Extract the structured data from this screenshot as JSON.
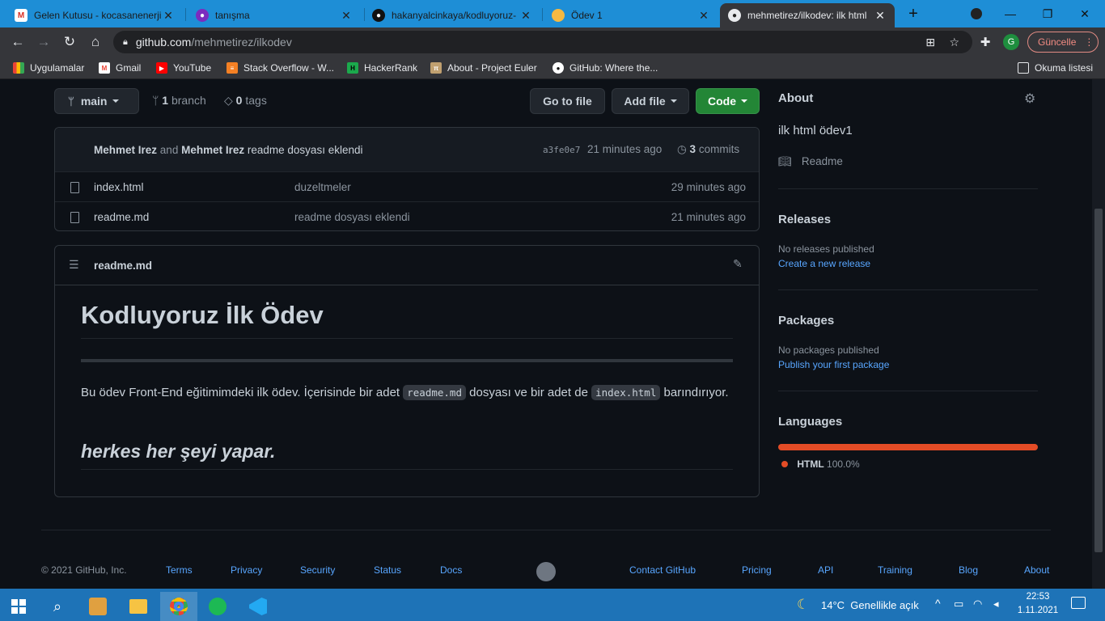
{
  "browser": {
    "tabs": [
      {
        "title": "Gelen Kutusu - kocasanenerji@",
        "fav_color": "#d93025"
      },
      {
        "title": "tanışma",
        "fav_color": "#7b2cbf"
      },
      {
        "title": "hakanyalcinkaya/kodluyoruz-",
        "fav_color": "#111111"
      },
      {
        "title": "Ödev 1",
        "fav_color": "#f5b942"
      },
      {
        "title": "mehmetirez/ilkodev: ilk html",
        "fav_color": "#111111"
      }
    ],
    "url_host": "github.com",
    "url_path": "/mehmetirez/ilkodev",
    "update_label": "Güncelle",
    "avatar_letter": "G",
    "bookmarks": [
      {
        "label": "Uygulamalar",
        "icon": "apps-grid-icon",
        "color": "#f4b400"
      },
      {
        "label": "Gmail",
        "icon": "gmail-icon",
        "color": "#ea4335"
      },
      {
        "label": "YouTube",
        "icon": "youtube-icon",
        "color": "#ff0000"
      },
      {
        "label": "Stack Overflow - W...",
        "icon": "stackoverflow-icon",
        "color": "#f48024"
      },
      {
        "label": "HackerRank",
        "icon": "hackerrank-icon",
        "color": "#1ba94c"
      },
      {
        "label": "About - Project Euler",
        "icon": "euler-icon",
        "color": "#c0a070"
      },
      {
        "label": "GitHub: Where the...",
        "icon": "github-icon",
        "color": "#ffffff"
      }
    ],
    "reading_list": "Okuma listesi"
  },
  "repo": {
    "branch": "main",
    "branch_count": "1",
    "branch_label": "branch",
    "tag_count": "0",
    "tag_label": "tags",
    "go_to_file": "Go to file",
    "add_file": "Add file",
    "code": "Code",
    "commit": {
      "author1": "Mehmet Irez",
      "and": "and",
      "author2": "Mehmet Irez",
      "message": "readme dosyası eklendi",
      "sha": "a3fe0e7",
      "time": "21 minutes ago",
      "count": "3",
      "count_label": "commits"
    },
    "files": [
      {
        "name": "index.html",
        "message": "duzeltmeler",
        "time": "29 minutes ago"
      },
      {
        "name": "readme.md",
        "message": "readme dosyası eklendi",
        "time": "21 minutes ago"
      }
    ]
  },
  "readme": {
    "filename": "readme.md",
    "heading": "Kodluyoruz İlk Ödev",
    "p_before": "Bu ödev Front-End eğitimimdeki ilk ödev. İçerisinde bir adet",
    "code1": "readme.md",
    "p_middle": "dosyası ve bir adet de",
    "code2": "index.html",
    "p_after": "barındırıyor.",
    "emphasis": "herkes her şeyi yapar."
  },
  "sidebar": {
    "about_title": "About",
    "description": "ilk html ödev1",
    "readme_link": "Readme",
    "releases_title": "Releases",
    "no_releases": "No releases published",
    "create_release": "Create a new release",
    "packages_title": "Packages",
    "no_packages": "No packages published",
    "publish_package": "Publish your first package",
    "languages_title": "Languages",
    "language_name": "HTML",
    "language_percent": "100.0%",
    "language_fraction": 1.0,
    "language_color": "#e34c26"
  },
  "footer": {
    "copyright": "© 2021 GitHub, Inc.",
    "links_left": [
      "Terms",
      "Privacy",
      "Security",
      "Status",
      "Docs"
    ],
    "links_right": [
      "Contact GitHub",
      "Pricing",
      "API",
      "Training",
      "Blog",
      "About"
    ]
  },
  "taskbar": {
    "weather": "14°C  Genellikle açık",
    "time": "22:53",
    "date": "1.11.2021"
  }
}
